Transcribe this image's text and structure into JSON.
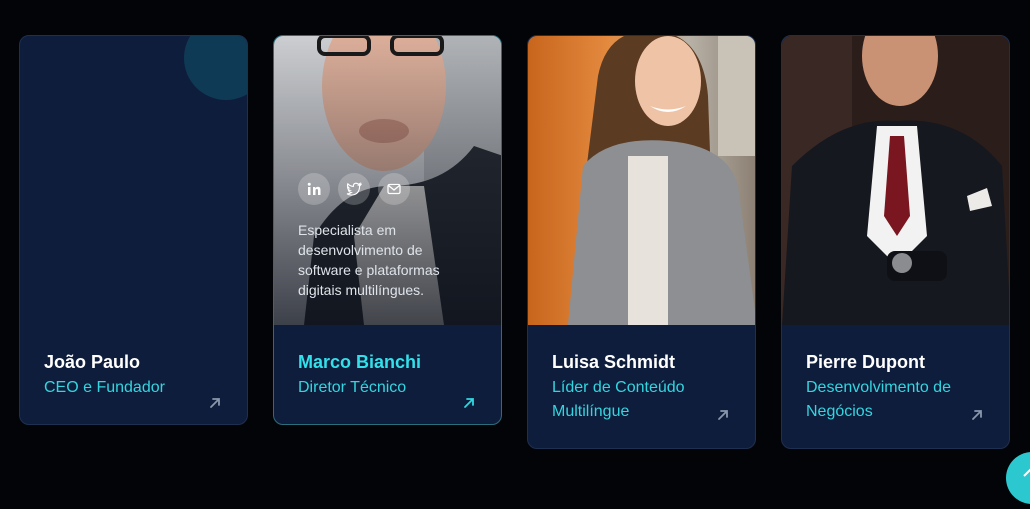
{
  "team": [
    {
      "name": "João Paulo",
      "role": "CEO e Fundador"
    },
    {
      "name": "Marco Bianchi",
      "role": "Diretor Técnico",
      "bio": "Especialista em desenvolvimento de software e plataformas digitais multilíngues.",
      "socials": [
        "linkedin-icon",
        "twitter-icon",
        "mail-icon"
      ]
    },
    {
      "name": "Luisa Schmidt",
      "role": "Líder de Conteúdo Multilíngue"
    },
    {
      "name": "Pierre Dupont",
      "role": "Desenvolvimento de Negócios"
    }
  ],
  "colors": {
    "background": "#030407",
    "card": "#0e1d3b",
    "accent": "#33d6e0",
    "fab": "#2cc8cf"
  }
}
